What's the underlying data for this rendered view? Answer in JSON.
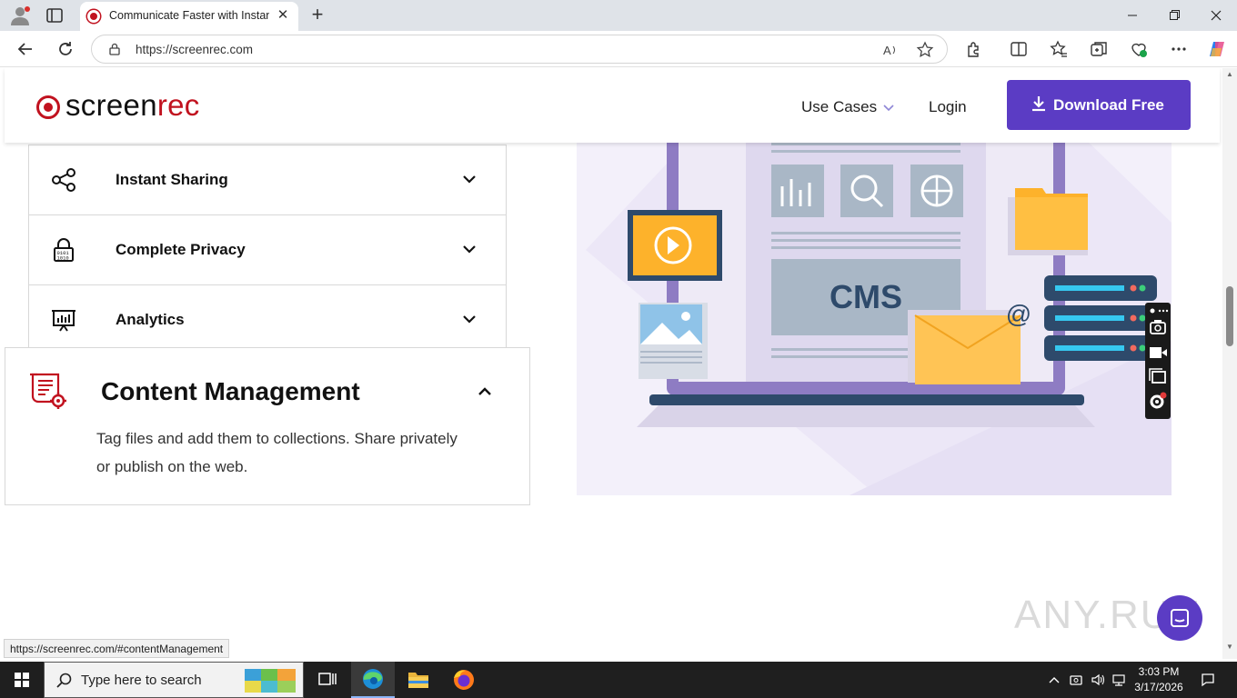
{
  "browser": {
    "tab_title": "Communicate Faster with Instant",
    "url": "https://screenrec.com",
    "new_tab": "+",
    "close_tab": "✕"
  },
  "header": {
    "logo_part1": "screen",
    "logo_part2": "rec",
    "nav_use_cases": "Use Cases",
    "nav_login": "Login",
    "download_button": "Download Free"
  },
  "features": {
    "items": [
      {
        "label": "Instant Sharing",
        "icon": "share-icon"
      },
      {
        "label": "Complete Privacy",
        "icon": "lock-icon"
      },
      {
        "label": "Analytics",
        "icon": "presentation-chart-icon"
      }
    ],
    "expanded": {
      "title": "Content Management",
      "icon": "document-gear-icon",
      "description": "Tag files and add them to collections. Share privately or publish on the web."
    }
  },
  "illustration": {
    "label": "CMS",
    "email_symbol": "@"
  },
  "overlay": {
    "watermark": "ANY.RUN",
    "status_link": "https://screenrec.com/#contentManagement"
  },
  "taskbar": {
    "search_placeholder": "Type here to search",
    "time": "3:03 PM",
    "date": "3/17/2026"
  },
  "colors": {
    "brand_red": "#c1121f",
    "brand_purple": "#5b3cc4",
    "illustration_bg": "#f3f0fa",
    "laptop_frame": "#8e7cc3",
    "accent_orange": "#fdb22b",
    "server_navy": "#2e4a6b"
  }
}
